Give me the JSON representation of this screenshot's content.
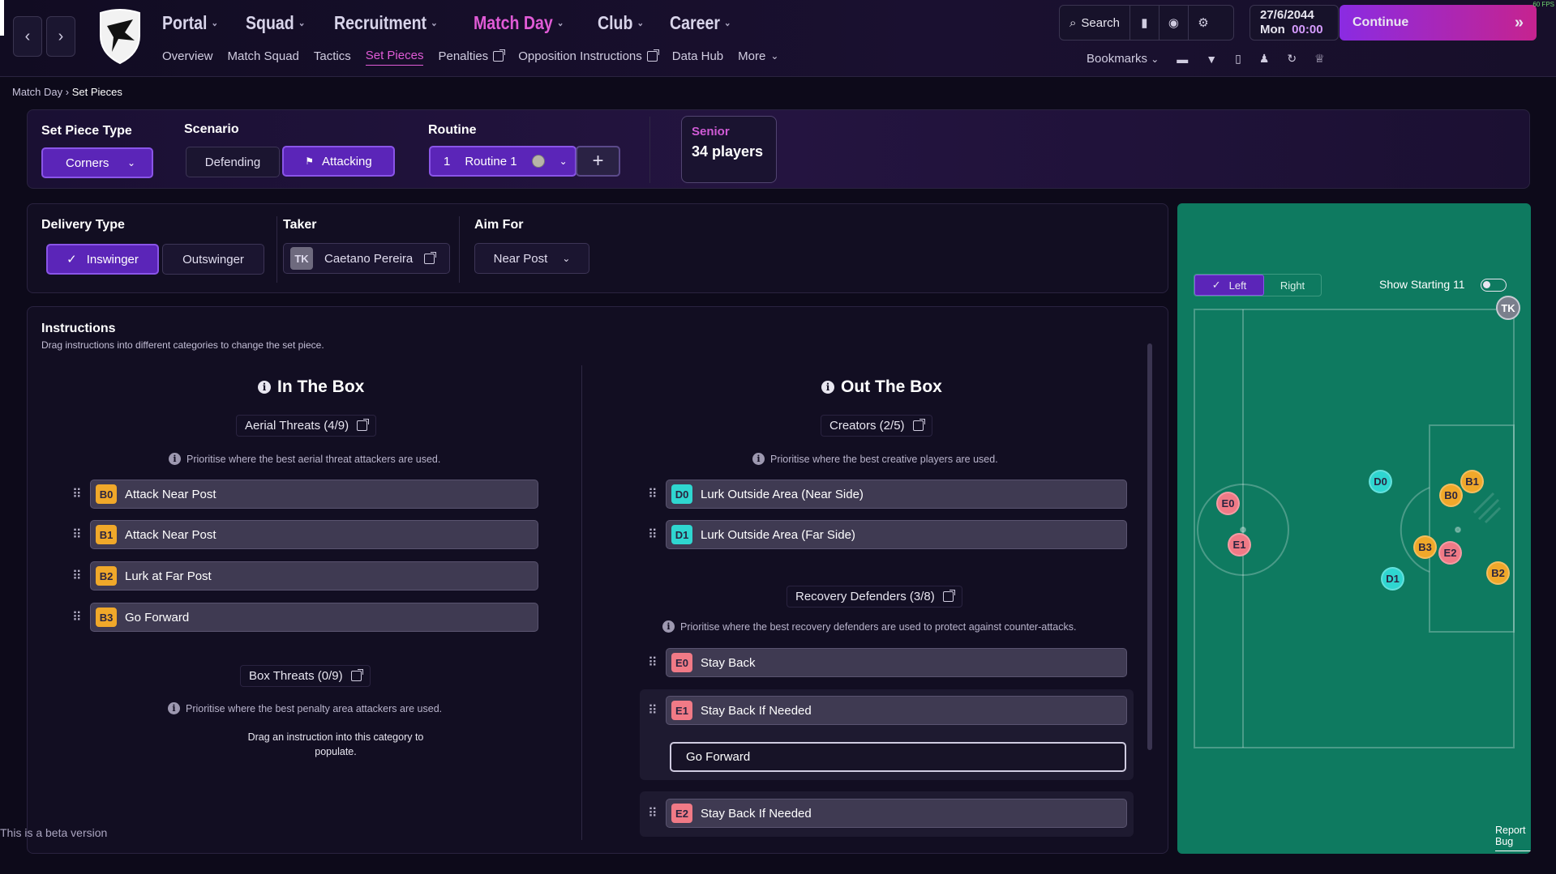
{
  "topbar": {
    "main_nav": [
      {
        "label": "Portal"
      },
      {
        "label": "Squad"
      },
      {
        "label": "Recruitment"
      },
      {
        "label": "Match Day",
        "active": true
      },
      {
        "label": "Club"
      },
      {
        "label": "Career"
      }
    ],
    "sub_nav": [
      {
        "label": "Overview"
      },
      {
        "label": "Match Squad"
      },
      {
        "label": "Tactics"
      },
      {
        "label": "Set Pieces",
        "active": true
      },
      {
        "label": "Penalties",
        "external": true
      },
      {
        "label": "Opposition Instructions",
        "external": true
      },
      {
        "label": "Data Hub"
      },
      {
        "label": "More",
        "dropdown": true
      }
    ],
    "search_label": "Search",
    "date": "27/6/2044",
    "day": "Mon",
    "time": "00:00",
    "continue_label": "Continue",
    "bookmarks_label": "Bookmarks",
    "fps": "60 FPS"
  },
  "breadcrumb": {
    "items": [
      "Match Day",
      "Set Pieces"
    ]
  },
  "setpiece": {
    "type_label": "Set Piece Type",
    "type_value": "Corners",
    "scenario_label": "Scenario",
    "scenario_options": [
      "Defending",
      "Attacking"
    ],
    "scenario_selected": "Attacking",
    "routine_label": "Routine",
    "routine_number": "1",
    "routine_name": "Routine 1",
    "squad_label": "Senior",
    "squad_count": "34 players"
  },
  "delivery": {
    "type_label": "Delivery Type",
    "options": [
      "Inswinger",
      "Outswinger"
    ],
    "selected": "Inswinger",
    "taker_label": "Taker",
    "taker_initials": "TK",
    "taker_name": "Caetano Pereira",
    "aim_label": "Aim For",
    "aim_value": "Near Post"
  },
  "instructions": {
    "title": "Instructions",
    "subtitle": "Drag instructions into different categories to change the set piece.",
    "in_box": {
      "title": "In The Box",
      "aerial": {
        "title": "Aerial Threats (4/9)",
        "hint": "Prioritise where the best aerial threat attackers are used.",
        "rows": [
          {
            "tag": "B0",
            "label": "Attack Near Post"
          },
          {
            "tag": "B1",
            "label": "Attack Near Post"
          },
          {
            "tag": "B2",
            "label": "Lurk at Far Post"
          },
          {
            "tag": "B3",
            "label": "Go Forward"
          }
        ]
      },
      "box": {
        "title": "Box Threats (0/9)",
        "hint": "Prioritise where the best penalty area attackers are used.",
        "empty_line1": "Drag an instruction into this category to",
        "empty_line2": "populate."
      }
    },
    "out_box": {
      "title": "Out The Box",
      "creators": {
        "title": "Creators (2/5)",
        "hint": "Prioritise where the best creative players are used.",
        "rows": [
          {
            "tag": "D0",
            "label": "Lurk Outside Area (Near Side)"
          },
          {
            "tag": "D1",
            "label": "Lurk Outside Area (Far Side)"
          }
        ]
      },
      "recovery": {
        "title": "Recovery Defenders (3/8)",
        "hint": "Prioritise where the best recovery defenders are used to protect against counter-attacks.",
        "rows": [
          {
            "tag": "E0",
            "label": "Stay Back"
          },
          {
            "tag": "E1",
            "label": "Stay Back If Needed"
          },
          {
            "tag": "E2",
            "label": "Stay Back If Needed"
          }
        ],
        "dropdown_option": "Go Forward"
      }
    },
    "beta_notice": "This is a beta version"
  },
  "pitch": {
    "side_options": [
      "Left",
      "Right"
    ],
    "side_selected": "Left",
    "show_starting_label": "Show Starting 11",
    "show_starting_on": false,
    "taker_tag": "TK",
    "players": [
      {
        "tag": "E0",
        "group": "r"
      },
      {
        "tag": "E1",
        "group": "r"
      },
      {
        "tag": "D0",
        "group": "c"
      },
      {
        "tag": "D1",
        "group": "c"
      },
      {
        "tag": "B0",
        "group": "y"
      },
      {
        "tag": "B1",
        "group": "y"
      },
      {
        "tag": "B2",
        "group": "y"
      },
      {
        "tag": "B3",
        "group": "y"
      },
      {
        "tag": "E2",
        "group": "r"
      }
    ],
    "report_bug": "Report Bug"
  },
  "colors": {
    "accent_pink": "#e05bd6",
    "accent_purple": "#5b25b8",
    "pitch": "#0e7a60",
    "aerial_tag": "#f0a82a",
    "creator_tag": "#2fd6d0",
    "recovery_tag": "#f07a86"
  }
}
